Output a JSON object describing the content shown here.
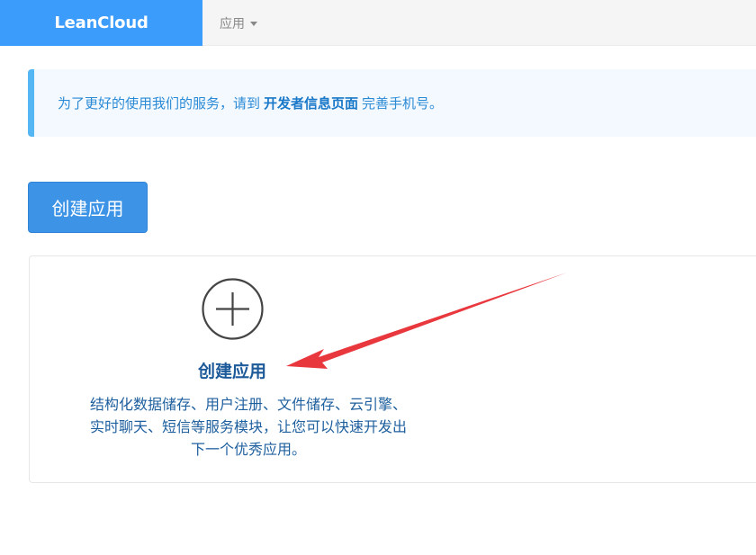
{
  "brand": {
    "name": "LeanCloud"
  },
  "nav": {
    "apps_label": "应用"
  },
  "notice": {
    "before": "为了更好的使用我们的服务，请到",
    "link": "开发者信息页面",
    "after": "完善手机号。"
  },
  "toolbar": {
    "create_label": "创建应用"
  },
  "card": {
    "title": "创建应用",
    "desc_line1": "结构化数据储存、用户注册、文件储存、云引擎、",
    "desc_line2": "实时聊天、短信等服务模块，让您可以快速开发出",
    "desc_line3": "下一个优秀应用。"
  },
  "colors": {
    "brand_bg": "#3c9cfb",
    "button_bg": "#3d94e6",
    "notice_accent": "#55b6f4",
    "annotation_arrow": "#e8373d"
  }
}
